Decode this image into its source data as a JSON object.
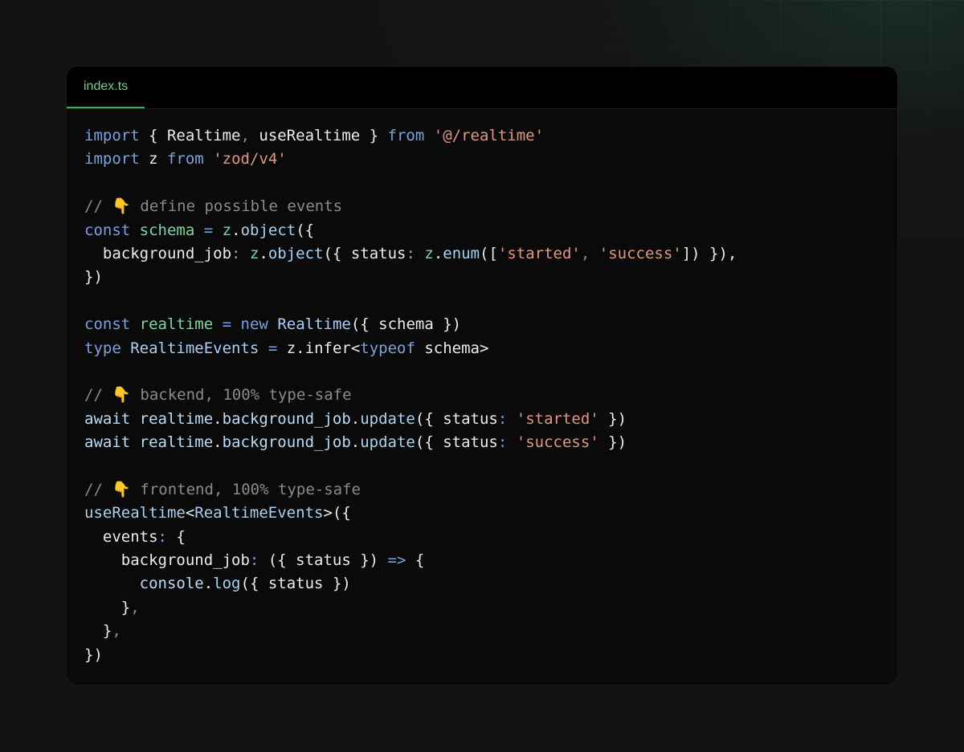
{
  "editor": {
    "tab_label": "index.ts",
    "colors": {
      "background": "#131313",
      "editor_background": "#0a0a0a",
      "tab_bar_background": "#000000",
      "tab_active_text": "#6fd08f",
      "keyword": "#7aa2e0",
      "string": "#e0977f",
      "comment": "#8a8a8a",
      "property": "#b9dcf7",
      "definition": "#7ed4a3",
      "text": "#ececec"
    },
    "code_lines": [
      [
        [
          "kw",
          "import"
        ],
        [
          "id",
          " { Realtime"
        ],
        [
          "cm",
          ","
        ],
        [
          "id",
          " useRealtime } "
        ],
        [
          "kw",
          "from"
        ],
        [
          "id",
          " "
        ],
        [
          "str",
          "'@/realtime'"
        ]
      ],
      [
        [
          "kw",
          "import"
        ],
        [
          "id",
          " z "
        ],
        [
          "kw",
          "from"
        ],
        [
          "id",
          " "
        ],
        [
          "str",
          "'zod/v4'"
        ]
      ],
      [],
      [
        [
          "cm",
          "// 👇 define possible events"
        ]
      ],
      [
        [
          "kw",
          "const"
        ],
        [
          "id",
          " "
        ],
        [
          "def",
          "schema"
        ],
        [
          "id",
          " "
        ],
        [
          "op",
          "="
        ],
        [
          "id",
          " "
        ],
        [
          "def",
          "z"
        ],
        [
          "punc",
          "."
        ],
        [
          "fn",
          "object"
        ],
        [
          "punc",
          "({"
        ]
      ],
      [
        [
          "id",
          "  background_job"
        ],
        [
          "op",
          ":"
        ],
        [
          "id",
          " "
        ],
        [
          "def",
          "z"
        ],
        [
          "punc",
          "."
        ],
        [
          "fn",
          "object"
        ],
        [
          "punc",
          "({ "
        ],
        [
          "id",
          "status"
        ],
        [
          "op",
          ":"
        ],
        [
          "id",
          " "
        ],
        [
          "def",
          "z"
        ],
        [
          "punc",
          "."
        ],
        [
          "fn",
          "enum"
        ],
        [
          "punc",
          "(["
        ],
        [
          "str",
          "'started'"
        ],
        [
          "cm",
          ","
        ],
        [
          "id",
          " "
        ],
        [
          "str",
          "'success'"
        ],
        [
          "punc",
          "]) }),"
        ]
      ],
      [
        [
          "punc",
          "})"
        ]
      ],
      [],
      [
        [
          "kw",
          "const"
        ],
        [
          "id",
          " "
        ],
        [
          "def",
          "realtime"
        ],
        [
          "id",
          " "
        ],
        [
          "op",
          "="
        ],
        [
          "id",
          " "
        ],
        [
          "kw",
          "new"
        ],
        [
          "id",
          " "
        ],
        [
          "type",
          "Realtime"
        ],
        [
          "punc",
          "({ "
        ],
        [
          "id",
          "schema"
        ],
        [
          "punc",
          " })"
        ]
      ],
      [
        [
          "kw",
          "type"
        ],
        [
          "id",
          " "
        ],
        [
          "type",
          "RealtimeEvents"
        ],
        [
          "id",
          " "
        ],
        [
          "op",
          "="
        ],
        [
          "id",
          " z"
        ],
        [
          "punc",
          "."
        ],
        [
          "id",
          "infer"
        ],
        [
          "punc",
          "<"
        ],
        [
          "kw",
          "typeof"
        ],
        [
          "id",
          " schema"
        ],
        [
          "punc",
          ">"
        ]
      ],
      [],
      [
        [
          "cm",
          "// 👇 backend, 100% type-safe"
        ]
      ],
      [
        [
          "prop",
          "await"
        ],
        [
          "id",
          " "
        ],
        [
          "prop",
          "realtime"
        ],
        [
          "punc",
          "."
        ],
        [
          "prop",
          "background_job"
        ],
        [
          "punc",
          "."
        ],
        [
          "fn",
          "update"
        ],
        [
          "punc",
          "({ "
        ],
        [
          "id",
          "status"
        ],
        [
          "op",
          ":"
        ],
        [
          "id",
          " "
        ],
        [
          "str",
          "'started'"
        ],
        [
          "punc",
          " })"
        ]
      ],
      [
        [
          "prop",
          "await"
        ],
        [
          "id",
          " "
        ],
        [
          "prop",
          "realtime"
        ],
        [
          "punc",
          "."
        ],
        [
          "prop",
          "background_job"
        ],
        [
          "punc",
          "."
        ],
        [
          "fn",
          "update"
        ],
        [
          "punc",
          "({ "
        ],
        [
          "id",
          "status"
        ],
        [
          "op",
          ":"
        ],
        [
          "id",
          " "
        ],
        [
          "str",
          "'success'"
        ],
        [
          "punc",
          " })"
        ]
      ],
      [],
      [
        [
          "cm",
          "// 👇 frontend, 100% type-safe"
        ]
      ],
      [
        [
          "fn",
          "useRealtime"
        ],
        [
          "punc",
          "<"
        ],
        [
          "type",
          "RealtimeEvents"
        ],
        [
          "punc",
          ">({"
        ]
      ],
      [
        [
          "id",
          "  events"
        ],
        [
          "op",
          ":"
        ],
        [
          "punc",
          " {"
        ]
      ],
      [
        [
          "id",
          "    background_job"
        ],
        [
          "op",
          ":"
        ],
        [
          "punc",
          " ({ "
        ],
        [
          "id",
          "status"
        ],
        [
          "punc",
          " }) "
        ],
        [
          "op",
          "=>"
        ],
        [
          "punc",
          " {"
        ]
      ],
      [
        [
          "id",
          "      "
        ],
        [
          "prop",
          "console"
        ],
        [
          "punc",
          "."
        ],
        [
          "fn",
          "log"
        ],
        [
          "punc",
          "({ "
        ],
        [
          "id",
          "status"
        ],
        [
          "punc",
          " })"
        ]
      ],
      [
        [
          "punc",
          "    }"
        ],
        [
          "cm",
          ","
        ]
      ],
      [
        [
          "punc",
          "  }"
        ],
        [
          "cm",
          ","
        ]
      ],
      [
        [
          "punc",
          "})"
        ]
      ]
    ]
  }
}
